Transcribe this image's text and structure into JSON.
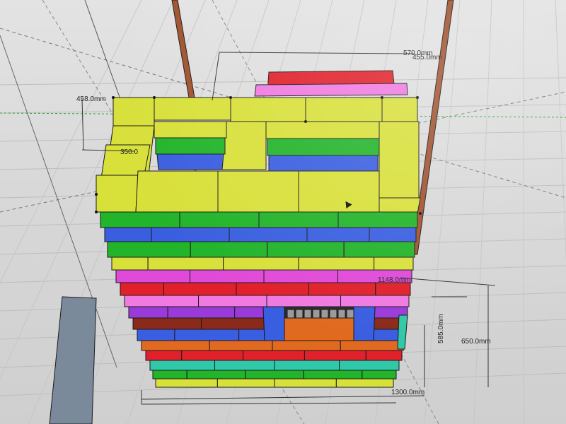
{
  "window": {
    "title": "",
    "colors": {
      "yellow": "#d8e03a",
      "green": "#22b42a",
      "blue": "#3a5ee0",
      "magenta": "#e04ad8",
      "pink": "#f07ae0",
      "red": "#e0202a",
      "purple": "#9a3ad8",
      "brown": "#8a2a1a",
      "orange": "#e06a20",
      "teal": "#30c8a8",
      "rod": "#a0522d",
      "guide_green": "#22aa22"
    }
  },
  "dimensions": {
    "width_top": "570.0mm",
    "depth_right": "455.0mm",
    "height_left": "458.0mm",
    "inner_left": "350.0",
    "mid_right": "1148.0mm",
    "lower_right_a": "585.0mm",
    "lower_right_b": "650.0mm",
    "base_width": "1300.0mm"
  },
  "cursor": {
    "icon": "cursor-arrow-icon"
  }
}
